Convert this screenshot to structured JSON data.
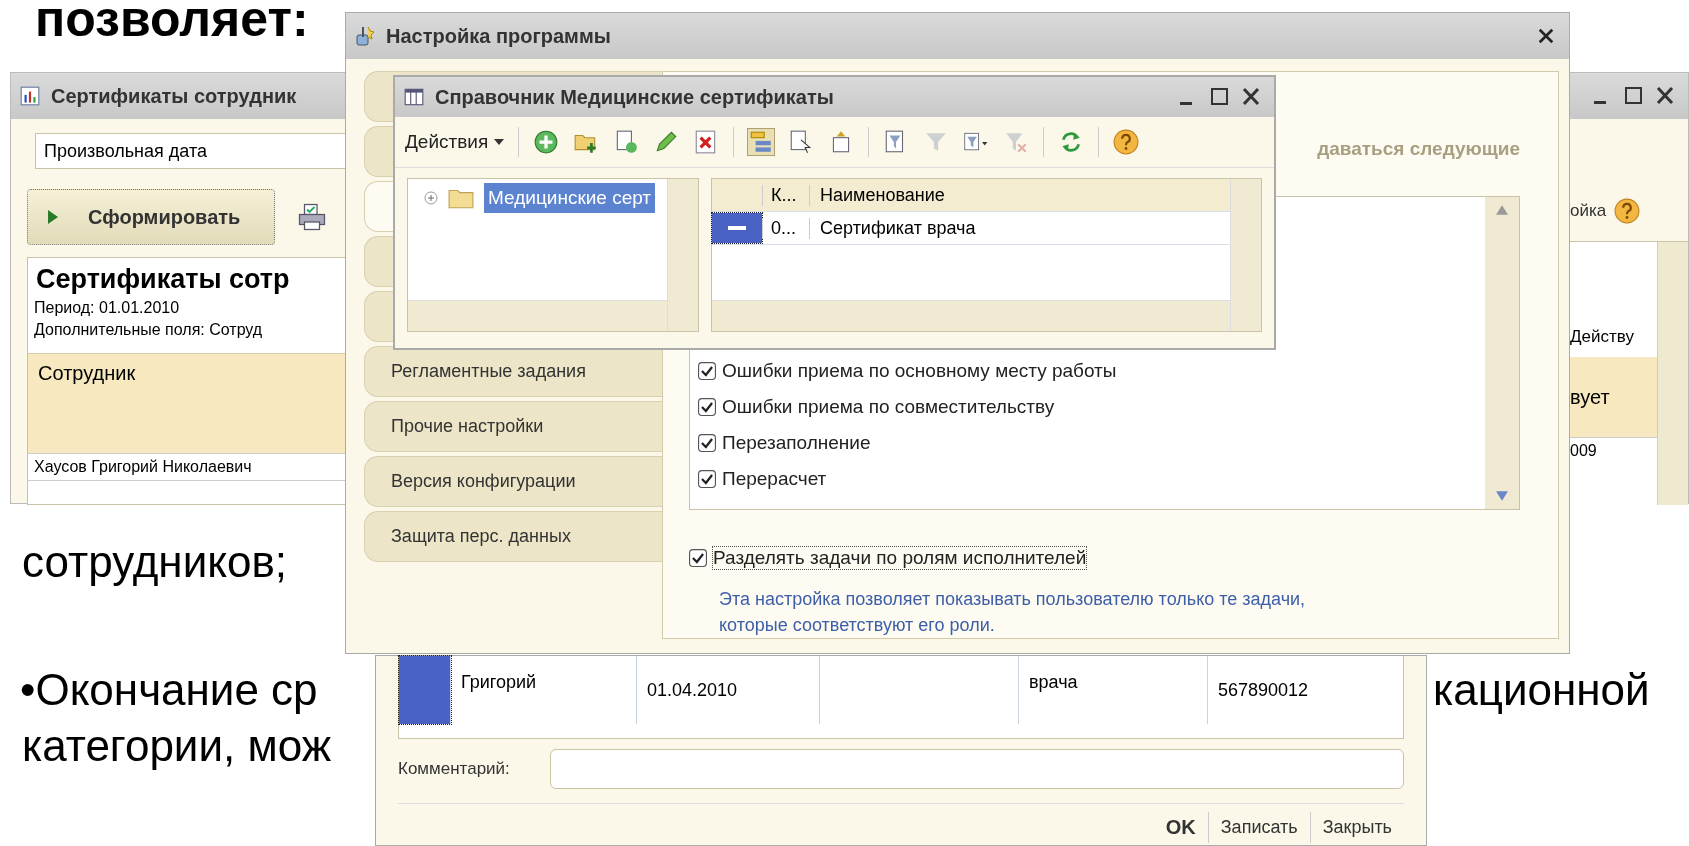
{
  "slide": {
    "heading": "позволяет:",
    "fragments": [
      {
        "text": "сотрудников;"
      },
      {
        "text": "•Окончание ср"
      },
      {
        "text": "категории, мож"
      },
      {
        "text": "кационной"
      }
    ]
  },
  "report_window": {
    "title": "Сертификаты сотрудник",
    "period_field": {
      "value": "Произвольная дата"
    },
    "generate_button": "Сформировать",
    "report_title": "Сертификаты сотр",
    "period": "Период: 01.01.2010",
    "extra_fields": "Дополнительные поля: Сотруд",
    "column_header": "Сотрудник",
    "row_cell": "Хаусов Григорий Николаевич",
    "settings_link": "ойка",
    "right_header_top": "Действу",
    "right_header": "вует",
    "right_cell": "009"
  },
  "settings_window": {
    "title": "Настройка программы",
    "tabs": [
      {
        "selected": false
      },
      {
        "selected": false
      },
      {
        "selected": true
      },
      {
        "selected": false
      },
      {
        "selected": false
      },
      {
        "label": "Регламентные задания",
        "selected": false
      },
      {
        "label": "Прочие настройки",
        "selected": false
      },
      {
        "label": "Версия конфигурации",
        "selected": false
      },
      {
        "label": "Защита перс. данных",
        "selected": false
      }
    ],
    "heading_fragment": "даваться следующие",
    "task_list": [
      {
        "label": "Ошибки приема по основному месту работы",
        "checked": true
      },
      {
        "label": "Ошибки приема по совместительству",
        "checked": true
      },
      {
        "label": "Перезаполнение",
        "checked": true
      },
      {
        "label": "Перерасчет",
        "checked": true
      }
    ],
    "split_tasks": {
      "label": "Разделять задачи по ролям исполнителей",
      "checked": true
    },
    "note": "Эта настройка позволяет показывать пользователю только те задачи, которые соответствуют его роли."
  },
  "catalog_window": {
    "title": "Справочник Медицинские сертификаты",
    "actions_menu": "Действия",
    "hierarchy_pressed": true,
    "tree": [
      {
        "label": "Медицинские серт",
        "selected": true,
        "expanded": false
      }
    ],
    "columns": [
      "К...",
      "Наименование"
    ],
    "rows": [
      {
        "code": "0...",
        "name": "Сертификат врача",
        "selected": true
      }
    ]
  },
  "certificate_window": {
    "row_cells": [
      {
        "text": "Григорий"
      },
      {
        "text": "01.04.2010"
      },
      {},
      {
        "text": "врача"
      },
      {
        "text": "567890012"
      }
    ],
    "row_selected": true,
    "comment_label": "Комментарий:",
    "buttons": [
      "OK",
      "Записать",
      "Закрыть"
    ]
  }
}
